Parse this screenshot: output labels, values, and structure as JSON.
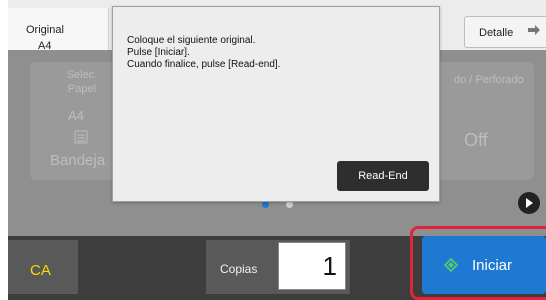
{
  "header": {
    "original_label": "Original",
    "original_value": "A4",
    "detail_label": "Detalle"
  },
  "panel": {
    "paper_select_title": "Selec. Papel",
    "paper_size": "A4",
    "paper_tray": "Bandeja",
    "staple_title": "do / Perforado",
    "staple_value": "Off"
  },
  "dialog": {
    "line1": "Coloque el siguiente original.",
    "line2": "Pulse [Iniciar].",
    "line3": "Cuando finalice, pulse [Read-end].",
    "read_end_label": "Read-End"
  },
  "bottom": {
    "ca_label": "CA",
    "copies_label": "Copias",
    "copies_value": "1",
    "start_label": "Iniciar"
  },
  "colors": {
    "accent": "#1f78d1",
    "highlight": "#e0243c",
    "ca_text": "#ffd800"
  },
  "icons": [
    "arrow-right-icon",
    "tray-icon",
    "play-icon",
    "start-icon"
  ]
}
